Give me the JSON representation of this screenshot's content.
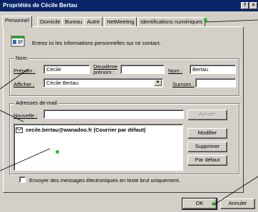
{
  "window": {
    "title": "Propriétés de Cécile Bertau",
    "help_label": "?",
    "close_label": "×"
  },
  "tabs": [
    {
      "label": "Personnel"
    },
    {
      "label": "Domicile"
    },
    {
      "label": "Bureau"
    },
    {
      "label": "Autre"
    },
    {
      "label": "NetMeeting"
    },
    {
      "label": "Identifications numériques"
    }
  ],
  "intro": {
    "text": "Entrez ici les informations personnelles sur ce contact.",
    "icon": "contact-card-icon"
  },
  "nom_group": {
    "title": "Nom",
    "prenom_label": "Prénom :",
    "prenom_value": "Cécile",
    "deuxieme_label_1": "Deuxième",
    "deuxieme_label_2": "prénom :",
    "deuxieme_value": "",
    "nom_label": "Nom :",
    "nom_value": "Bertau",
    "afficher_label": "Afficher :",
    "afficher_value": "Cécile Bertau",
    "surnom_label": "Surnom :",
    "surnom_value": ""
  },
  "email_group": {
    "title": "Adresses de-mail",
    "nouvelle_label": "Nouvelle :",
    "nouvelle_value": "",
    "ajouter_label": "Ajouter",
    "emails": [
      {
        "address": "cecile.bertau@wanadoo.fr",
        "note": "(Courrier par défaut)"
      }
    ],
    "modifier_label": "Modifier",
    "supprimer_label": "Supprimer",
    "par_defaut_label": "Par défaut"
  },
  "plain_text_option": {
    "label": "Envoyer des messages électroniques en texte brut uniquement.",
    "checked": false
  },
  "footer": {
    "ok_label": "OK",
    "cancel_label": "Annuler"
  },
  "colors": {
    "callout": "#1fbf2a",
    "titlebar": "#0a246a",
    "window": "#d4d0c8"
  }
}
